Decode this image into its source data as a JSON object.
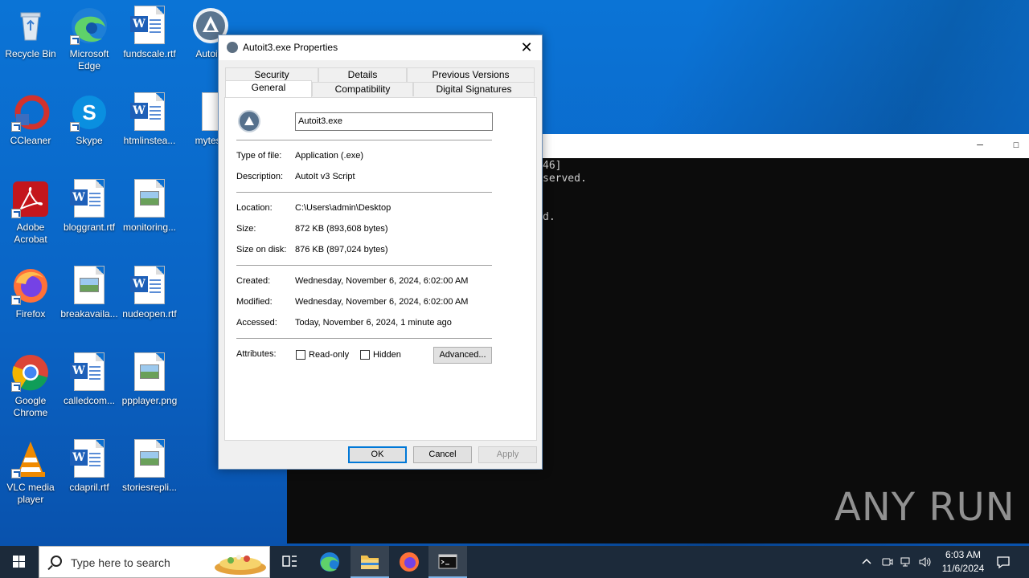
{
  "desktop_icons": [
    {
      "label": "Recycle Bin"
    },
    {
      "label": "Microsoft Edge"
    },
    {
      "label": "fundscale.rtf"
    },
    {
      "label": "Autoit3"
    },
    {
      "label": "CCleaner"
    },
    {
      "label": "Skype"
    },
    {
      "label": "htmlinstea..."
    },
    {
      "label": "mytes2"
    },
    {
      "label": "Adobe Acrobat"
    },
    {
      "label": "bloggrant.rtf"
    },
    {
      "label": "monitoring..."
    },
    {
      "label": "Firefox"
    },
    {
      "label": "breakavaila..."
    },
    {
      "label": "nudeopen.rtf"
    },
    {
      "label": "Google Chrome"
    },
    {
      "label": "calledcom..."
    },
    {
      "label": "ppplayer.png"
    },
    {
      "label": "VLC media player"
    },
    {
      "label": "cdapril.rtf"
    },
    {
      "label": "storiesrepli..."
    }
  ],
  "console": {
    "lines": [
      "46]",
      "served.",
      "",
      "d."
    ]
  },
  "dialog": {
    "title": "Autoit3.exe Properties",
    "tabs_top": [
      "Security",
      "Details",
      "Previous Versions"
    ],
    "tabs_bottom": [
      "General",
      "Compatibility",
      "Digital Signatures"
    ],
    "active_tab": "General",
    "file_name": "Autoit3.exe",
    "fields": {
      "type_label": "Type of file:",
      "type_value": "Application (.exe)",
      "desc_label": "Description:",
      "desc_value": "AutoIt v3 Script",
      "location_label": "Location:",
      "location_value": "C:\\Users\\admin\\Desktop",
      "size_label": "Size:",
      "size_value": "872 KB (893,608 bytes)",
      "disk_label": "Size on disk:",
      "disk_value": "876 KB (897,024 bytes)",
      "created_label": "Created:",
      "created_value": "Wednesday, November 6, 2024, 6:02:00 AM",
      "modified_label": "Modified:",
      "modified_value": "Wednesday, November 6, 2024, 6:02:00 AM",
      "accessed_label": "Accessed:",
      "accessed_value": "Today, November 6, 2024, 1 minute ago",
      "attributes_label": "Attributes:"
    },
    "readonly_label": "Read-only",
    "hidden_label": "Hidden",
    "advanced_label": "Advanced...",
    "ok_label": "OK",
    "cancel_label": "Cancel",
    "apply_label": "Apply"
  },
  "taskbar": {
    "search_placeholder": "Type here to search",
    "time": "6:03 AM",
    "date": "11/6/2024"
  },
  "watermark": "ANY RUN",
  "colors": {
    "accent": "#0078d7",
    "desktop": "#0a6fd1",
    "taskbar": "#1c2a3a"
  }
}
